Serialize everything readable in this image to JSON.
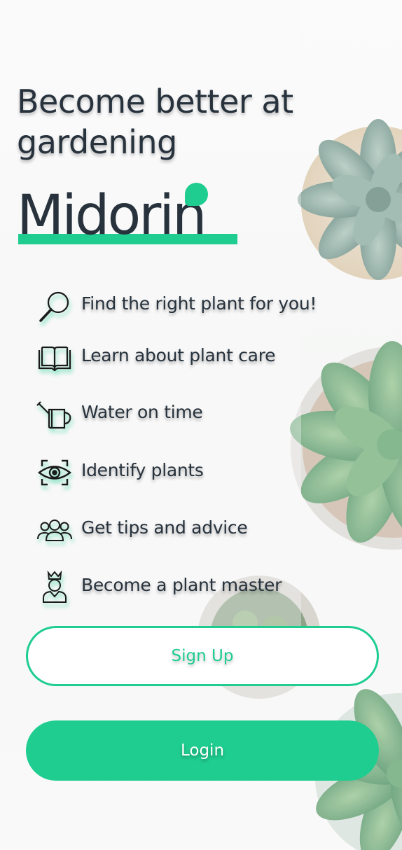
{
  "headline": "Become better at gardening",
  "brand": {
    "name": "Midorin",
    "accent_color": "#1fcd91",
    "text_color": "#27323d"
  },
  "features": [
    {
      "icon": "magnifier-icon",
      "label": "Find the right plant for you!"
    },
    {
      "icon": "open-book-icon",
      "label": "Learn about plant care"
    },
    {
      "icon": "watering-can-icon",
      "label": "Water on time"
    },
    {
      "icon": "eye-scan-icon",
      "label": "Identify plants"
    },
    {
      "icon": "people-group-icon",
      "label": "Get tips and advice"
    },
    {
      "icon": "crowned-person-icon",
      "label": "Become a plant master"
    }
  ],
  "buttons": {
    "signup_label": "Sign Up",
    "login_label": "Login"
  }
}
